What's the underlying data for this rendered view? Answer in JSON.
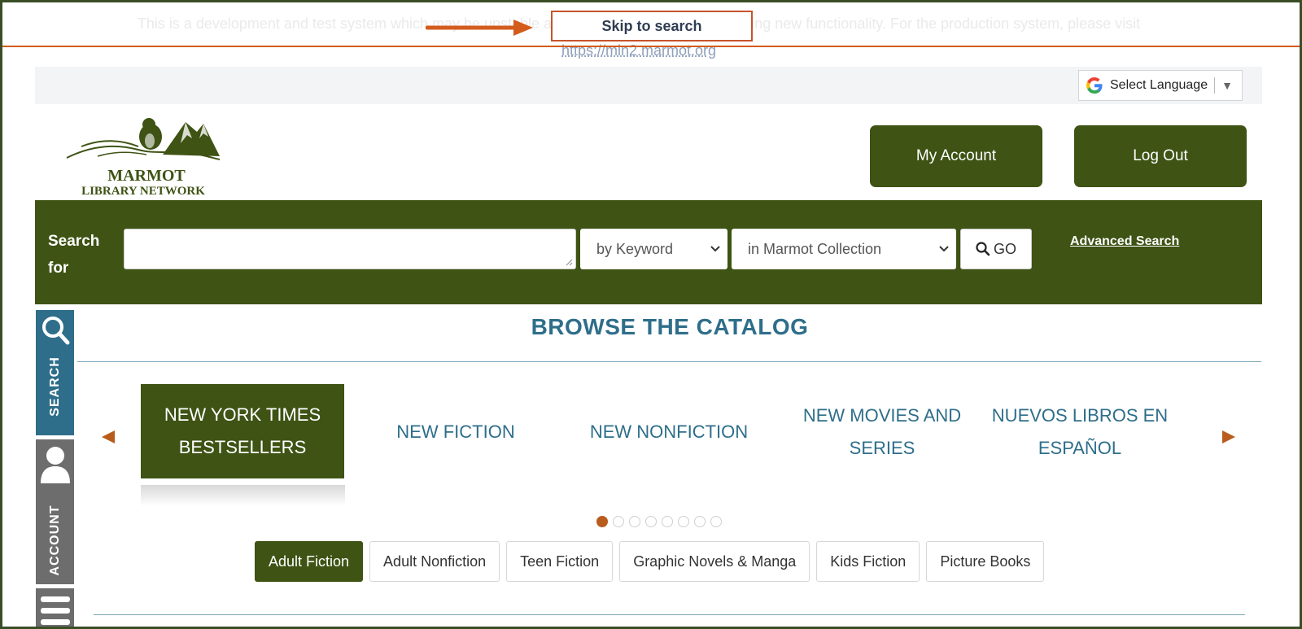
{
  "banner": {
    "text": "This is a development and test system which may be unstable and should only be used for testing new functionality. For the production system, please visit",
    "link": "https://min2.marmot.org",
    "skip_label": "Skip to search"
  },
  "language": {
    "label": "Select Language",
    "arrow": "▼"
  },
  "logo": {
    "line1": "MARMOT",
    "line2": "LIBRARY NETWORK"
  },
  "header": {
    "my_account": "My Account",
    "log_out": "Log Out"
  },
  "search": {
    "label_line1": "Search",
    "label_line2": "for",
    "input_value": "",
    "type_selected": "by Keyword",
    "scope_selected": "in Marmot Collection",
    "go_label": "GO",
    "advanced_label": "Advanced Search"
  },
  "sidebar": {
    "search_label": "SEARCH",
    "account_label": "ACCOUNT"
  },
  "browse": {
    "title": "BROWSE THE CATALOG",
    "categories": [
      {
        "label": "NEW YORK TIMES BESTSELLERS"
      },
      {
        "label": "NEW FICTION"
      },
      {
        "label": "NEW NONFICTION"
      },
      {
        "label": "NEW MOVIES AND SERIES"
      },
      {
        "label": "NUEVOS LIBROS EN ESPAÑOL"
      }
    ],
    "active_dot": 1,
    "dot_count": 8,
    "tabs": [
      {
        "label": "Adult Fiction"
      },
      {
        "label": "Adult Nonfiction"
      },
      {
        "label": "Teen Fiction"
      },
      {
        "label": "Graphic Novels & Manga"
      },
      {
        "label": "Kids Fiction"
      },
      {
        "label": "Picture Books"
      }
    ]
  },
  "colors": {
    "brand_green": "#3e5314",
    "browse_blue": "#2e6e8a",
    "accent_orange": "#b85c1d",
    "annotation_orange": "#d35c1c"
  }
}
